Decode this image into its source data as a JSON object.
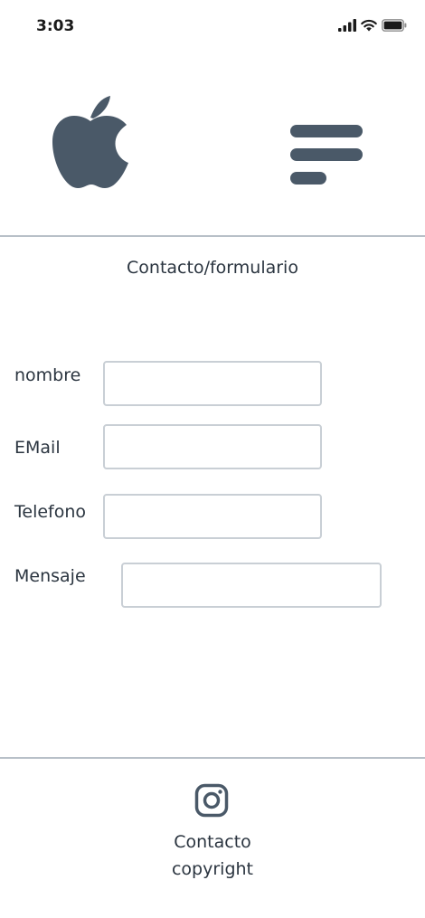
{
  "status_bar": {
    "time": "3:03",
    "icons": [
      "cellular-signal-icon",
      "wifi-icon",
      "battery-icon"
    ]
  },
  "header": {
    "logo_icon": "apple-logo-icon",
    "menu_icon": "hamburger-menu-icon"
  },
  "page": {
    "title": "Contacto/formulario"
  },
  "form": {
    "fields": [
      {
        "label": "nombre",
        "value": "",
        "placeholder": ""
      },
      {
        "label": "EMail",
        "value": "",
        "placeholder": ""
      },
      {
        "label": "Telefono",
        "value": "",
        "placeholder": ""
      },
      {
        "label": "Mensaje",
        "value": "",
        "placeholder": ""
      }
    ]
  },
  "footer": {
    "social_icon": "instagram-icon",
    "contact_text": "Contacto",
    "copyright_text": "copyright"
  },
  "colors": {
    "icon": "#4a5968",
    "divider": "#b8c0c8",
    "input_border": "#c9cfd5",
    "text": "#2b3540"
  }
}
